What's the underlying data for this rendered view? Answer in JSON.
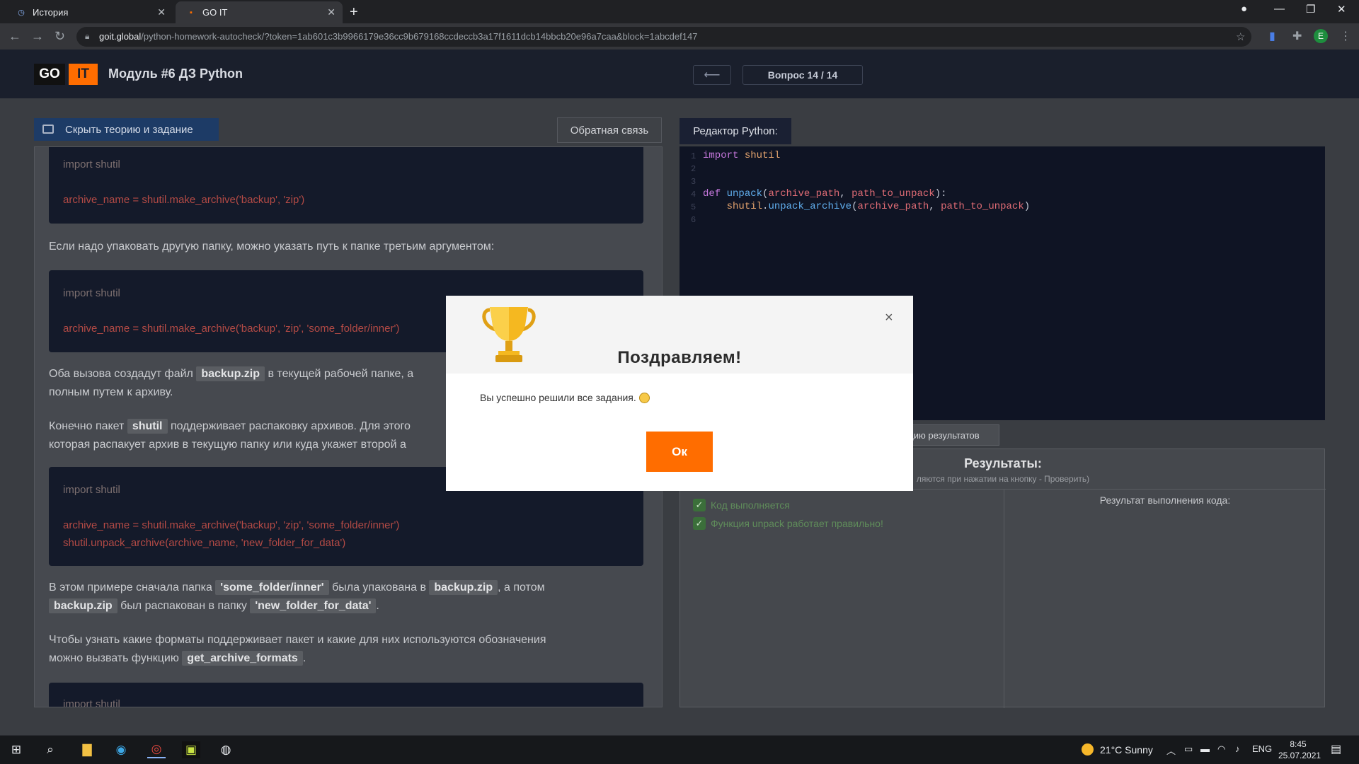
{
  "browser": {
    "tabs": [
      {
        "label": "История",
        "active": false
      },
      {
        "label": "GO IT",
        "active": true
      }
    ],
    "url_domain": "goit.global",
    "url_path": "/python-homework-autocheck/?token=1ab601c3b9966179e36cc9b679168ccdeccb3a17f1611dcb14bbcb20e96a7caa&block=1abcdef147"
  },
  "header": {
    "logo_go": "GO",
    "logo_it": "IT",
    "module_title": "Модуль #6 ДЗ Python",
    "question_counter": "Вопрос 14 / 14"
  },
  "left_panel": {
    "hide_theory_label": "Скрыть теорию и задание",
    "feedback_label": "Обратная связь",
    "code1": [
      "import shutil",
      "archive_name = shutil.make_archive('backup', 'zip')"
    ],
    "para1": "Если надо упаковать другую папку, можно указать путь к папке третьим аргументом:",
    "code2": [
      "import shutil",
      "archive_name = shutil.make_archive('backup', 'zip', 'some_folder/inner')"
    ],
    "para2_a": "Оба вызова создадут файл",
    "para2_chip": "backup.zip",
    "para2_b": "в текущей рабочей папке, а",
    "para2_c": "полным путем к архиву.",
    "para3_a": "Конечно пакет",
    "para3_chip": "shutil",
    "para3_b": "поддерживает распаковку архивов. Для этого",
    "para3_c": "которая распакует архив в текущую папку или куда укажет второй а",
    "code3": [
      "import shutil",
      "archive_name = shutil.make_archive('backup', 'zip', 'some_folder/inner')",
      "shutil.unpack_archive(archive_name, 'new_folder_for_data')"
    ],
    "para4_a": "В этом примере сначала папка",
    "para4_chip1": "'some_folder/inner'",
    "para4_b": "была упакована в",
    "para4_chip2": "backup.zip",
    "para4_c": ", а потом",
    "para4_chip3": "backup.zip",
    "para4_d": "был распакован в папку",
    "para4_chip4": "'new_folder_for_data'",
    "para4_e": ".",
    "para5_a": "Чтобы узнать какие форматы поддерживает пакет и какие для них используются обозначения",
    "para5_b": "можно вызвать функцию",
    "para5_chip": "get_archive_formats",
    "para5_c": ".",
    "code4_partial": "import shutil"
  },
  "editor": {
    "tab_label": "Редактор Python:",
    "line_numbers": [
      "1",
      "2",
      "3",
      "4",
      "5",
      "6"
    ],
    "line1": {
      "kw": "import",
      "mod": "shutil"
    },
    "line4": {
      "kw": "def",
      "fn": "unpack",
      "open": "(",
      "p1": "archive_path",
      "sep": ", ",
      "p2": "path_to_unpack",
      "close": "):"
    },
    "line5": {
      "obj": "shutil",
      "dot": ".",
      "fn": "unpack_archive",
      "open": "(",
      "p1": "archive_path",
      "sep": ", ",
      "p2": "path_to_unpack",
      "close": ")"
    }
  },
  "results": {
    "results_button_partial": "цию результатов",
    "title": "Результаты:",
    "subtitle_partial": "ляются при нажатии на кнопку - Проверить)",
    "code_output_label": "Результат выполнения кода:",
    "checks": [
      {
        "label": "Код выполняется",
        "passed": true
      },
      {
        "label": "Функция unpack работает правильно!",
        "passed": true
      }
    ]
  },
  "modal": {
    "title": "Поздравляем!",
    "message": "Вы успешно решили все задания.",
    "ok_label": "Ок",
    "close_symbol": "×"
  },
  "taskbar": {
    "weather": "21°C  Sunny",
    "language": "ENG",
    "time": "8:45",
    "date": "25.07.2021"
  },
  "colors": {
    "brand_orange": "#ff6d00",
    "header_bg": "#1a1f2c",
    "editor_bg": "#0f1424"
  }
}
